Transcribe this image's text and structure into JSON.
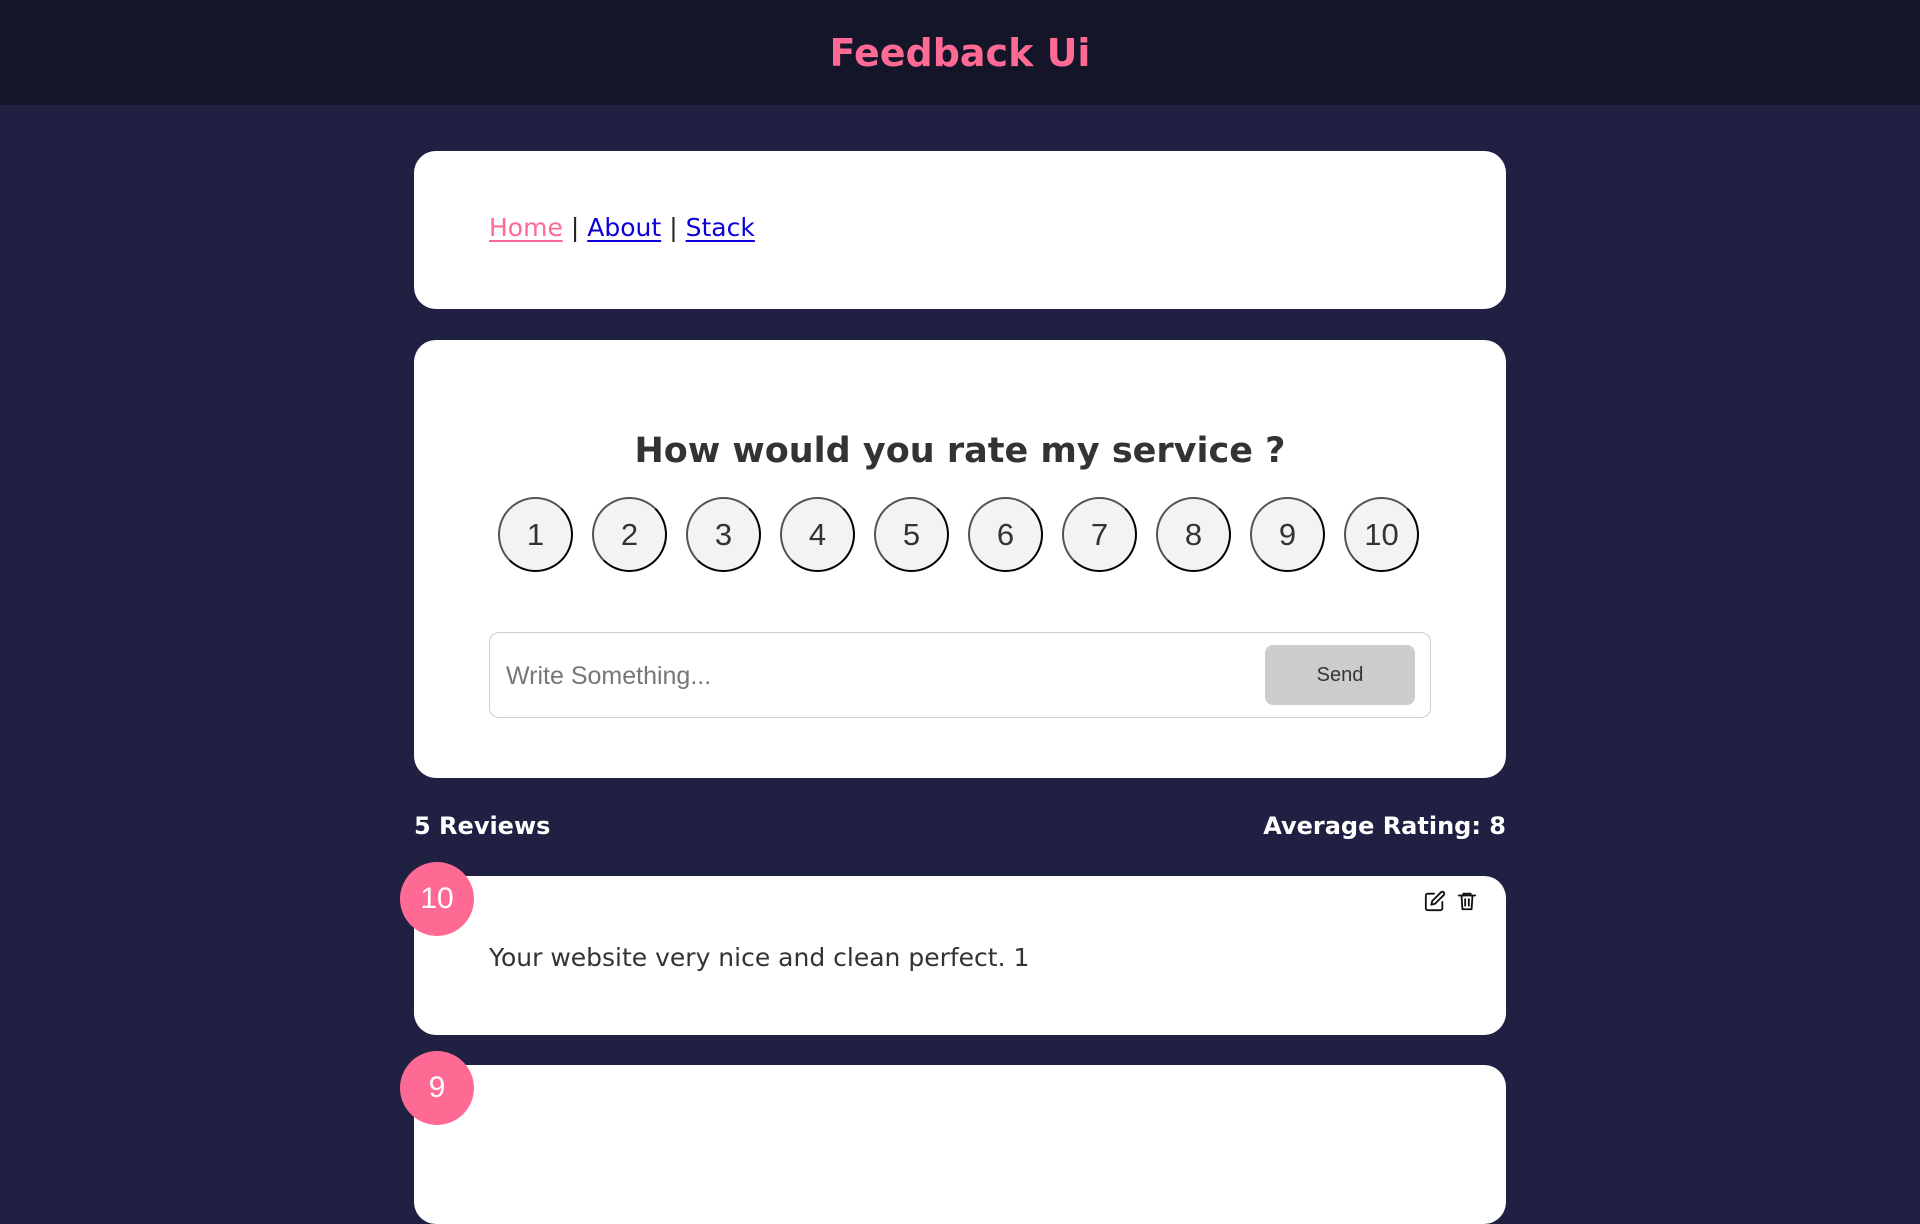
{
  "header": {
    "title": "Feedback Ui"
  },
  "nav": {
    "home": "Home",
    "separator_1": "|",
    "about": "About",
    "separator_2": "|",
    "stack": "Stack"
  },
  "rating_form": {
    "question": "How would you rate my service ?",
    "options": [
      "1",
      "2",
      "3",
      "4",
      "5",
      "6",
      "7",
      "8",
      "9",
      "10"
    ],
    "input_placeholder": "Write Something...",
    "send_label": "Send"
  },
  "stats": {
    "reviews_count": "5 Reviews",
    "average_rating": "Average Rating: 8"
  },
  "reviews": [
    {
      "rating": "10",
      "text": "Your website very nice and clean perfect. 1",
      "actions": [
        "edit-icon",
        "trash-icon"
      ]
    },
    {
      "rating": "9"
    }
  ],
  "colors": {
    "brand": "#ff6a95",
    "background": "#202142",
    "header_background": "#141529",
    "card_background": "#ffffff",
    "link": "#0b00d8"
  }
}
